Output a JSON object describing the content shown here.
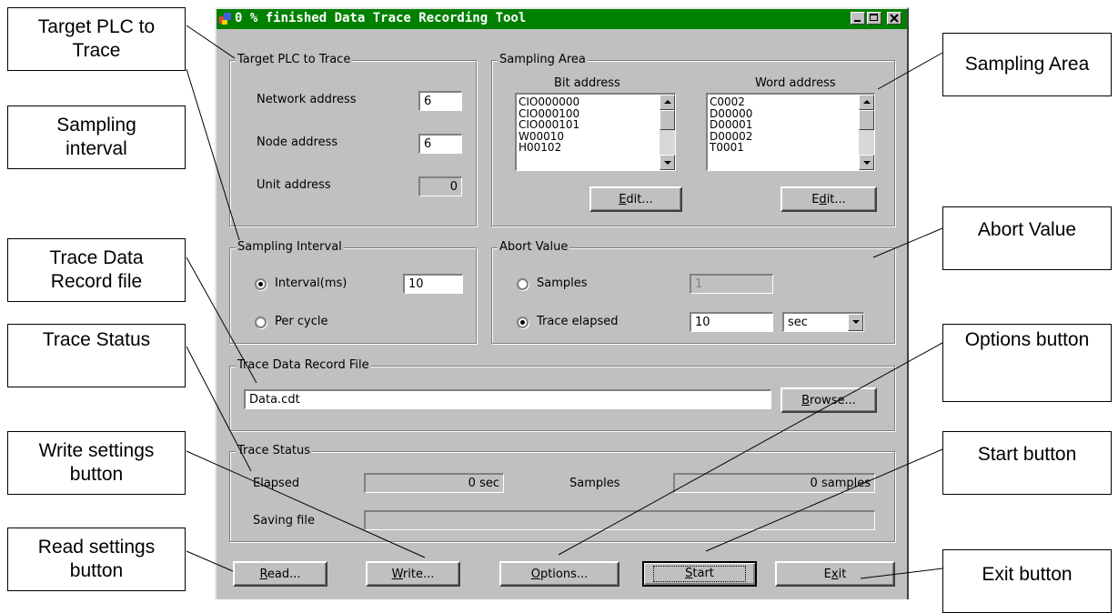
{
  "window": {
    "title": "0 % finished Data Trace Recording Tool"
  },
  "target": {
    "group": "Target PLC to Trace",
    "network_label": "Network address",
    "network_value": "6",
    "node_label": "Node address",
    "node_value": "6",
    "unit_label": "Unit address",
    "unit_value": "0"
  },
  "sampling_area": {
    "group": "Sampling Area",
    "bit_header": "Bit address",
    "word_header": "Word address",
    "bit_items": [
      "CIO000000",
      "CIO000100",
      "CIO000101",
      "W00010",
      "H00102"
    ],
    "word_items": [
      "C0002",
      "D00000",
      "D00001",
      "D00002",
      "T0001"
    ],
    "edit_bit_pre": "",
    "edit_bit_key": "E",
    "edit_bit_post": "dit...",
    "edit_word_pre": "E",
    "edit_word_key": "d",
    "edit_word_post": "it..."
  },
  "interval": {
    "group": "Sampling Interval",
    "interval_label": "Interval(ms)",
    "interval_value": "10",
    "per_cycle_label": "Per cycle"
  },
  "abort": {
    "group": "Abort Value",
    "samples_label": "Samples",
    "samples_value": "1",
    "elapsed_label": "Trace elapsed",
    "elapsed_value": "10",
    "unit_selected": "sec"
  },
  "record": {
    "group": "Trace Data Record File",
    "file_value": "Data.cdt",
    "browse_key": "B",
    "browse_rest": "rowse..."
  },
  "status": {
    "group": "Trace Status",
    "elapsed_label": "Elapsed",
    "elapsed_value": "0 sec",
    "samples_label": "Samples",
    "samples_value": "0 samples",
    "saving_label": "Saving file",
    "saving_value": ""
  },
  "buttons": {
    "read_key": "R",
    "read_rest": "ead...",
    "write_key": "W",
    "write_rest": "rite...",
    "options_key": "O",
    "options_rest": "ptions...",
    "start_key": "S",
    "start_rest": "tart",
    "exit_pre": "E",
    "exit_key": "x",
    "exit_rest": "it"
  },
  "callouts": {
    "target_plc": "Target PLC to Trace",
    "sampling_interval": "Sampling interval",
    "trace_data_record": "Trace Data Record file",
    "trace_status": "Trace Status",
    "write_settings": "Write settings button",
    "read_settings": "Read settings button",
    "sampling_area": "Sampling Area",
    "abort_value": "Abort Value",
    "options_button": "Options button",
    "start_button": "Start button",
    "exit_button": "Exit button"
  },
  "colors": {
    "titlebar": "#008000",
    "dialog_face": "#c0c0c0"
  }
}
